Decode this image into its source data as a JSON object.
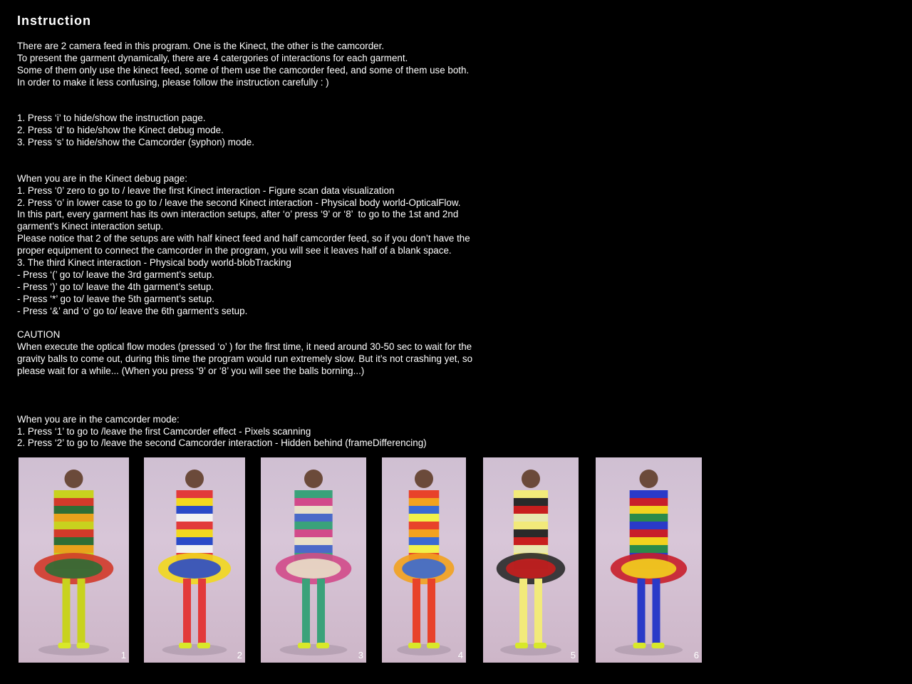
{
  "title": "Instruction",
  "lines": [
    "There are 2 camera feed in this program. One is the Kinect, the other is the camcorder.",
    "To present the garment dynamically, there are 4 catergories of interactions for each garment.",
    "Some of them only use the kinect feed, some of them use the camcorder feed, and some of them use both.",
    "In order to make it less confusing, please follow the instruction carefully : )",
    "",
    "",
    "1. Press ‘i’ to hide/show the instruction page.",
    "2. Press ‘d’ to hide/show the Kinect debug mode.",
    "3. Press ‘s’ to hide/show the Camcorder (syphon) mode.",
    "",
    "",
    "When you are in the Kinect debug page:",
    "1. Press ‘0’ zero to go to / leave the first Kinect interaction - Figure scan data visualization",
    "2. Press ‘o’ in lower case to go to / leave the second Kinect interaction - Physical body world-OpticalFlow.",
    "In this part, every garment has its own interaction setups, after ‘o’ press ‘9’ or ‘8’  to go to the 1st and 2nd",
    "garment’s Kinect interaction setup.",
    "Please notice that 2 of the setups are with half kinect feed and half camcorder feed, so if you don’t have the",
    "proper equipment to connect the camcorder in the program, you will see it leaves half of a blank space.",
    "3. The third Kinect interaction - Physical body world-blobTracking",
    "- Press ‘(’ go to/ leave the 3rd garment’s setup.",
    "- Press ‘)’ go to/ leave the 4th garment’s setup.",
    "- Press ‘*’ go to/ leave the 5th garment’s setup.",
    "- Press ‘&’ and ‘o’ go to/ leave the 6th garment’s setup.",
    "",
    "CAUTION",
    "When execute the optical flow modes (pressed ‘o’ ) for the first time, it need around 30-50 sec to wait for the",
    "gravity balls to come out, during this time the program would run extremely slow. But it’s not crashing yet, so",
    "please wait for a while... (When you press ‘9’ or ‘8’ you will see the balls borning...)",
    "",
    "",
    "",
    "When you are in the camcorder mode:",
    "1. Press ‘1’ to go to /leave the first Camcorder effect - Pixels scanning",
    "2. Press ‘2’ to go to /leave the second Camcorder interaction - Hidden behind (frameDifferencing)"
  ],
  "photos": [
    {
      "number": "1",
      "colors": [
        "#c8d21e",
        "#d23a2a",
        "#2e6e35",
        "#e8a21c"
      ]
    },
    {
      "number": "2",
      "colors": [
        "#e23a3a",
        "#f2d81e",
        "#2a4bc8",
        "#f2f2f2"
      ]
    },
    {
      "number": "3",
      "colors": [
        "#3aa27a",
        "#d24a8a",
        "#e8e0c8",
        "#4a6ac8"
      ]
    },
    {
      "number": "4",
      "colors": [
        "#e8422a",
        "#f2a21e",
        "#3a6ad2",
        "#f2f24a"
      ]
    },
    {
      "number": "5",
      "colors": [
        "#f2ea7a",
        "#2a2a2a",
        "#c81e1e",
        "#e8e8b0"
      ]
    },
    {
      "number": "6",
      "colors": [
        "#2a3ac8",
        "#c81e2a",
        "#f2d21e",
        "#2a8a4a"
      ]
    }
  ]
}
